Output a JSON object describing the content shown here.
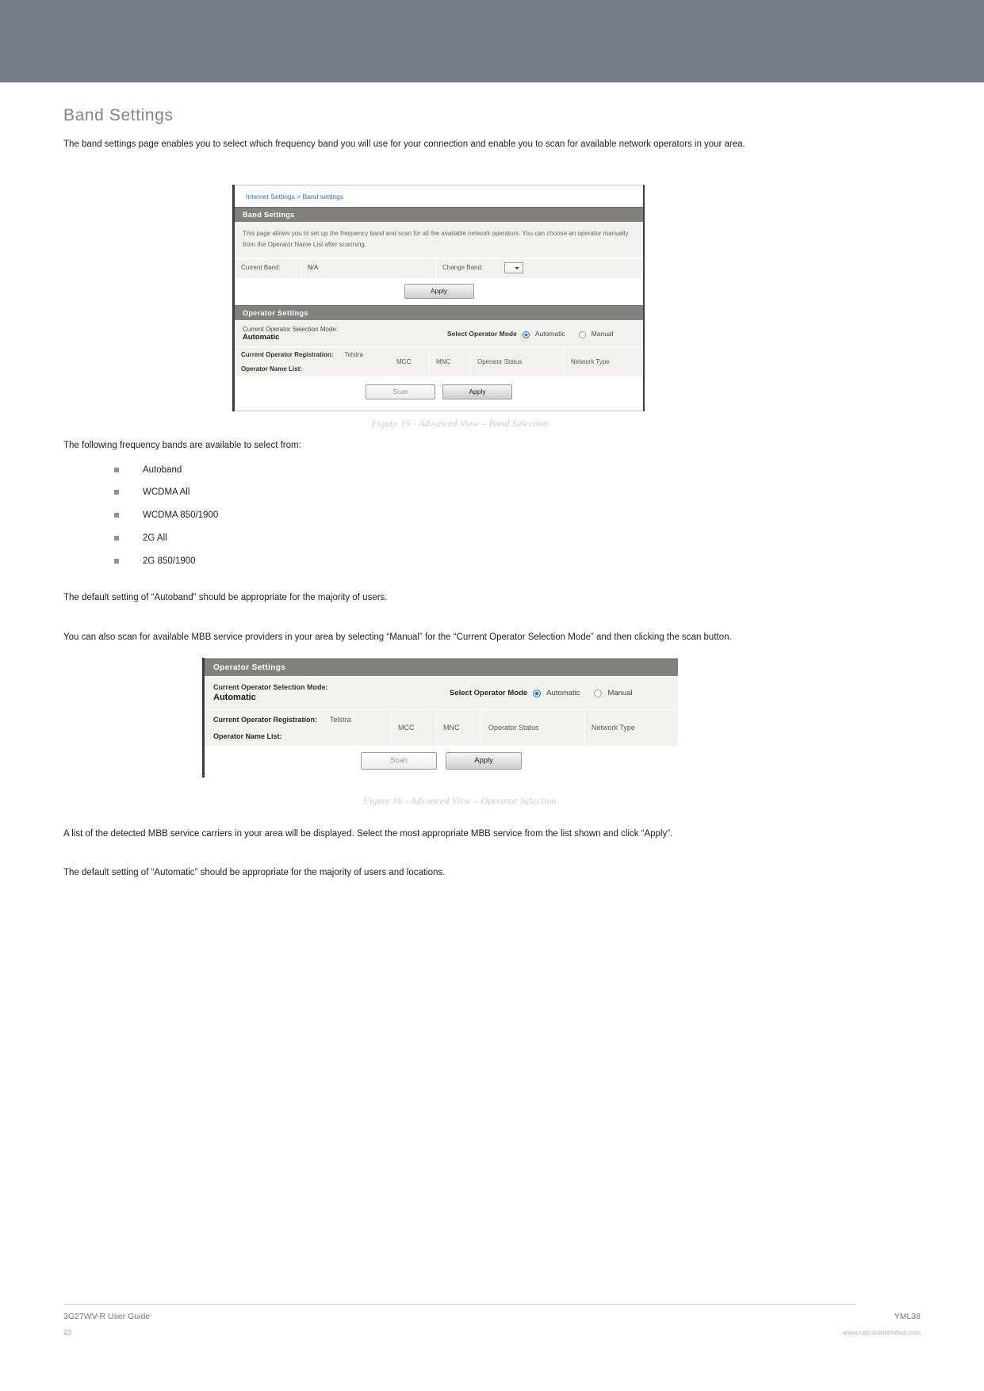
{
  "page": {
    "title": "Band Settings",
    "intro": "The band settings page enables you to select which frequency band you will use for your connection and enable you to scan for available network operators in your area.",
    "bands_intro": "The following frequency bands are available to select from:",
    "bands": [
      "Autoband",
      "WCDMA All",
      "WCDMA 850/1900",
      "2G All",
      "2G 850/1900"
    ],
    "default_note": "The default setting of “Autoband” should be appropriate for the majority of users.",
    "manual_note": "You can also scan for available MBB service providers in your area by selecting “Manual” for the “Current Operator Selection Mode” and then clicking the scan button.",
    "list_note": "A list of the detected MBB service carriers in your area will be displayed. Select the most appropriate MBB service from the list shown and click “Apply”.",
    "default_auto_note": "The default setting of “Automatic” should be appropriate for the majority of users and locations."
  },
  "figure15": {
    "caption": "Figure 15 - Advanced View – Band Selection",
    "breadcrumb": "Internet Settings > Band settings",
    "band_section_title": "Band Settings",
    "band_description": "This page allows you to set up the frequency band and scan for all the available network operators. You can choose an operator manually from the Operator Name List after scanning.",
    "current_band_label": "Current Band:",
    "current_band_value": "N/A",
    "change_band_label": "Change Band:",
    "change_band_value": "",
    "apply_label": "Apply",
    "operator_section_title": "Operator Settings",
    "selection_mode_label": "Current Operator Selection Mode:",
    "selection_mode_value": "Automatic",
    "select_operator_mode_label": "Select Operator Mode",
    "radio_automatic": "Automatic",
    "radio_manual": "Manual",
    "registration_label": "Current Operator Registration:",
    "registration_value": "Telstra",
    "operator_name_list_label": "Operator Name List:",
    "col_mcc": "MCC",
    "col_mnc": "MNC",
    "col_status": "Operator Status",
    "col_network_type": "Network Type",
    "scan_label": "Scan"
  },
  "figure16": {
    "caption": "Figure 16 - Advanced View – Operator Selection",
    "operator_section_title": "Operator Settings",
    "selection_mode_label": "Current Operator Selection Mode:",
    "selection_mode_value": "Automatic",
    "select_operator_mode_label": "Select Operator Mode",
    "radio_automatic": "Automatic",
    "radio_manual": "Manual",
    "registration_label": "Current Operator Registration:",
    "registration_value": "Telstra",
    "operator_name_list_label": "Operator Name List:",
    "col_mcc": "MCC",
    "col_mnc": "MNC",
    "col_status": "Operator Status",
    "col_network_type": "Network Type",
    "scan_label": "Scan",
    "apply_label": "Apply"
  },
  "footer": {
    "left": "3G27WV-R User Guide",
    "page_number": "23",
    "right": "YML38",
    "url": "www.netcommlimited.com"
  },
  "colors": {
    "banner": "#737d89",
    "heading": "#7b849a",
    "link": "#2c6fbb",
    "section_header": "#83817e"
  }
}
